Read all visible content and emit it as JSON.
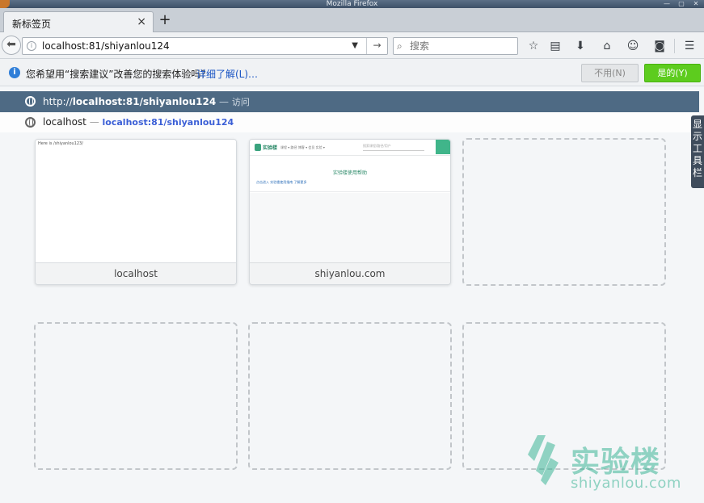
{
  "window": {
    "title": "Mozilla Firefox"
  },
  "tab": {
    "title": "新标签页",
    "close_glyph": "×",
    "new_tab_glyph": "+"
  },
  "navbar": {
    "url": "localhost:81/shiyanlou124",
    "search_placeholder": "搜索"
  },
  "notification": {
    "text": "您希望用“搜索建议”改善您的搜索体验吗？",
    "link": "详细了解(L)…",
    "no_button": "不用(N)",
    "yes_button": "是的(Y)"
  },
  "autocomplete": {
    "first": {
      "prefix": "http://",
      "url_bold": "localhost:81/shiyanlou124",
      "sep": "—",
      "action": "访问"
    },
    "second": {
      "title": "localhost",
      "sep": "—",
      "url": "localhost:81/shiyanlou124"
    }
  },
  "sidebar_button": {
    "chars": [
      "显",
      "示",
      "工",
      "具",
      "栏"
    ]
  },
  "tiles": [
    {
      "label": "localhost",
      "thumb_text": "Here is /shiyanlou123/"
    },
    {
      "label": "shiyanlou.com",
      "thumb_brand": "实验楼",
      "thumb_nav": "课程 ▾   路径   博客 ▾   会员   实验 ▾",
      "thumb_search": "搜索课程/路径/用户",
      "thumb_heading": "实验楼使用帮助",
      "thumb_link": "点击进入 实验楼使用指南 了解更多"
    }
  ],
  "watermark": {
    "title": "实验楼",
    "domain": "shiyanlou.com"
  },
  "colors": {
    "selected_row": "#4e6a84",
    "yes_button": "#5dcc1e",
    "brand_green": "#3aa37e"
  }
}
